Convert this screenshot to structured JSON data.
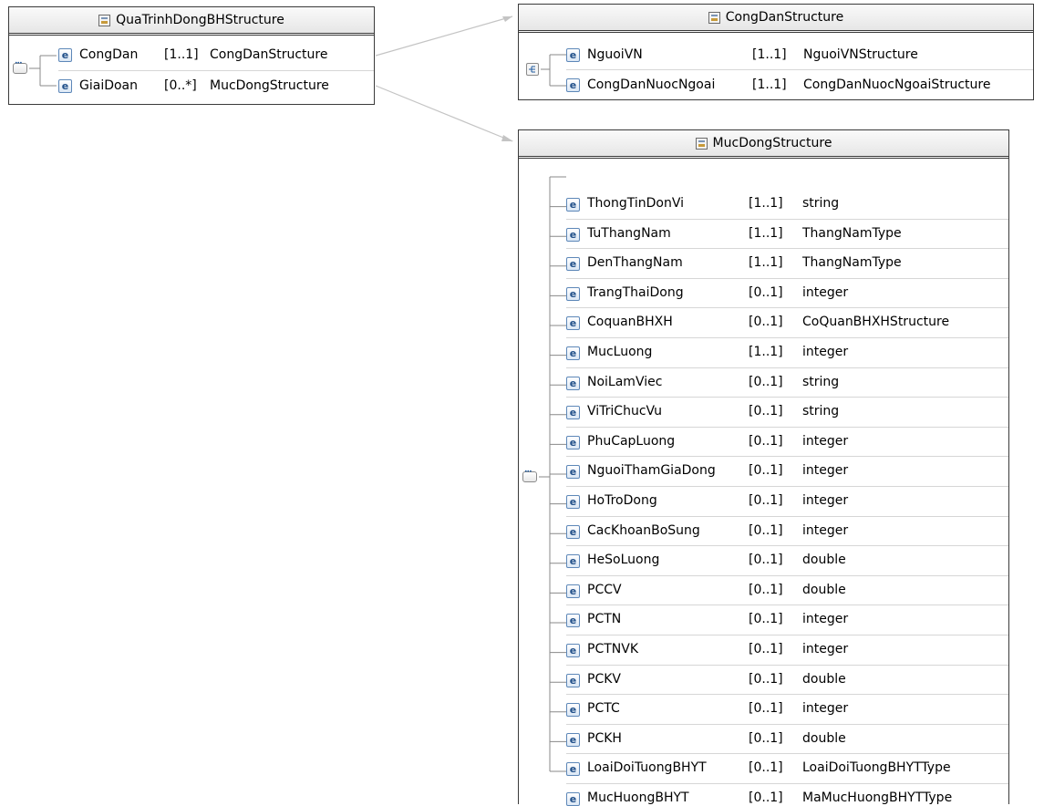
{
  "structures": {
    "qua_trinh": {
      "title": "QuaTrinhDongBHStructure",
      "elements": [
        {
          "name": "CongDan",
          "cardinality": "[1..1]",
          "type": "CongDanStructure"
        },
        {
          "name": "GiaiDoan",
          "cardinality": "[0..*]",
          "type": "MucDongStructure"
        }
      ]
    },
    "cong_dan": {
      "title": "CongDanStructure",
      "elements": [
        {
          "name": "NguoiVN",
          "cardinality": "[1..1]",
          "type": "NguoiVNStructure"
        },
        {
          "name": "CongDanNuocNgoai",
          "cardinality": "[1..1]",
          "type": "CongDanNuocNgoaiStructure"
        }
      ]
    },
    "muc_dong": {
      "title": "MucDongStructure",
      "elements": [
        {
          "name": "ThongTinDonVi",
          "cardinality": "[1..1]",
          "type": "string"
        },
        {
          "name": "TuThangNam",
          "cardinality": "[1..1]",
          "type": "ThangNamType"
        },
        {
          "name": "DenThangNam",
          "cardinality": "[1..1]",
          "type": "ThangNamType"
        },
        {
          "name": "TrangThaiDong",
          "cardinality": "[0..1]",
          "type": "integer"
        },
        {
          "name": "CoquanBHXH",
          "cardinality": "[0..1]",
          "type": "CoQuanBHXHStructure"
        },
        {
          "name": "MucLuong",
          "cardinality": "[1..1]",
          "type": "integer"
        },
        {
          "name": "NoiLamViec",
          "cardinality": "[0..1]",
          "type": "string"
        },
        {
          "name": "ViTriChucVu",
          "cardinality": "[0..1]",
          "type": "string"
        },
        {
          "name": "PhuCapLuong",
          "cardinality": "[0..1]",
          "type": "integer"
        },
        {
          "name": "NguoiThamGiaDong",
          "cardinality": "[0..1]",
          "type": "integer"
        },
        {
          "name": "HoTroDong",
          "cardinality": "[0..1]",
          "type": "integer"
        },
        {
          "name": "CacKhoanBoSung",
          "cardinality": "[0..1]",
          "type": "integer"
        },
        {
          "name": "HeSoLuong",
          "cardinality": "[0..1]",
          "type": "double"
        },
        {
          "name": "PCCV",
          "cardinality": "[0..1]",
          "type": "double"
        },
        {
          "name": "PCTN",
          "cardinality": "[0..1]",
          "type": "integer"
        },
        {
          "name": "PCTNVK",
          "cardinality": "[0..1]",
          "type": "integer"
        },
        {
          "name": "PCKV",
          "cardinality": "[0..1]",
          "type": "double"
        },
        {
          "name": "PCTC",
          "cardinality": "[0..1]",
          "type": "integer"
        },
        {
          "name": "PCKH",
          "cardinality": "[0..1]",
          "type": "double"
        },
        {
          "name": "LoaiDoiTuongBHYT",
          "cardinality": "[0..1]",
          "type": "LoaiDoiTuongBHYTType"
        },
        {
          "name": "MucHuongBHYT",
          "cardinality": "[0..1]",
          "type": "MaMucHuongBHYTType"
        }
      ]
    }
  },
  "icons": {
    "element": "e",
    "structure": "complex-type-icon",
    "sequence": "sequence-icon",
    "choice": "choice-icon"
  }
}
